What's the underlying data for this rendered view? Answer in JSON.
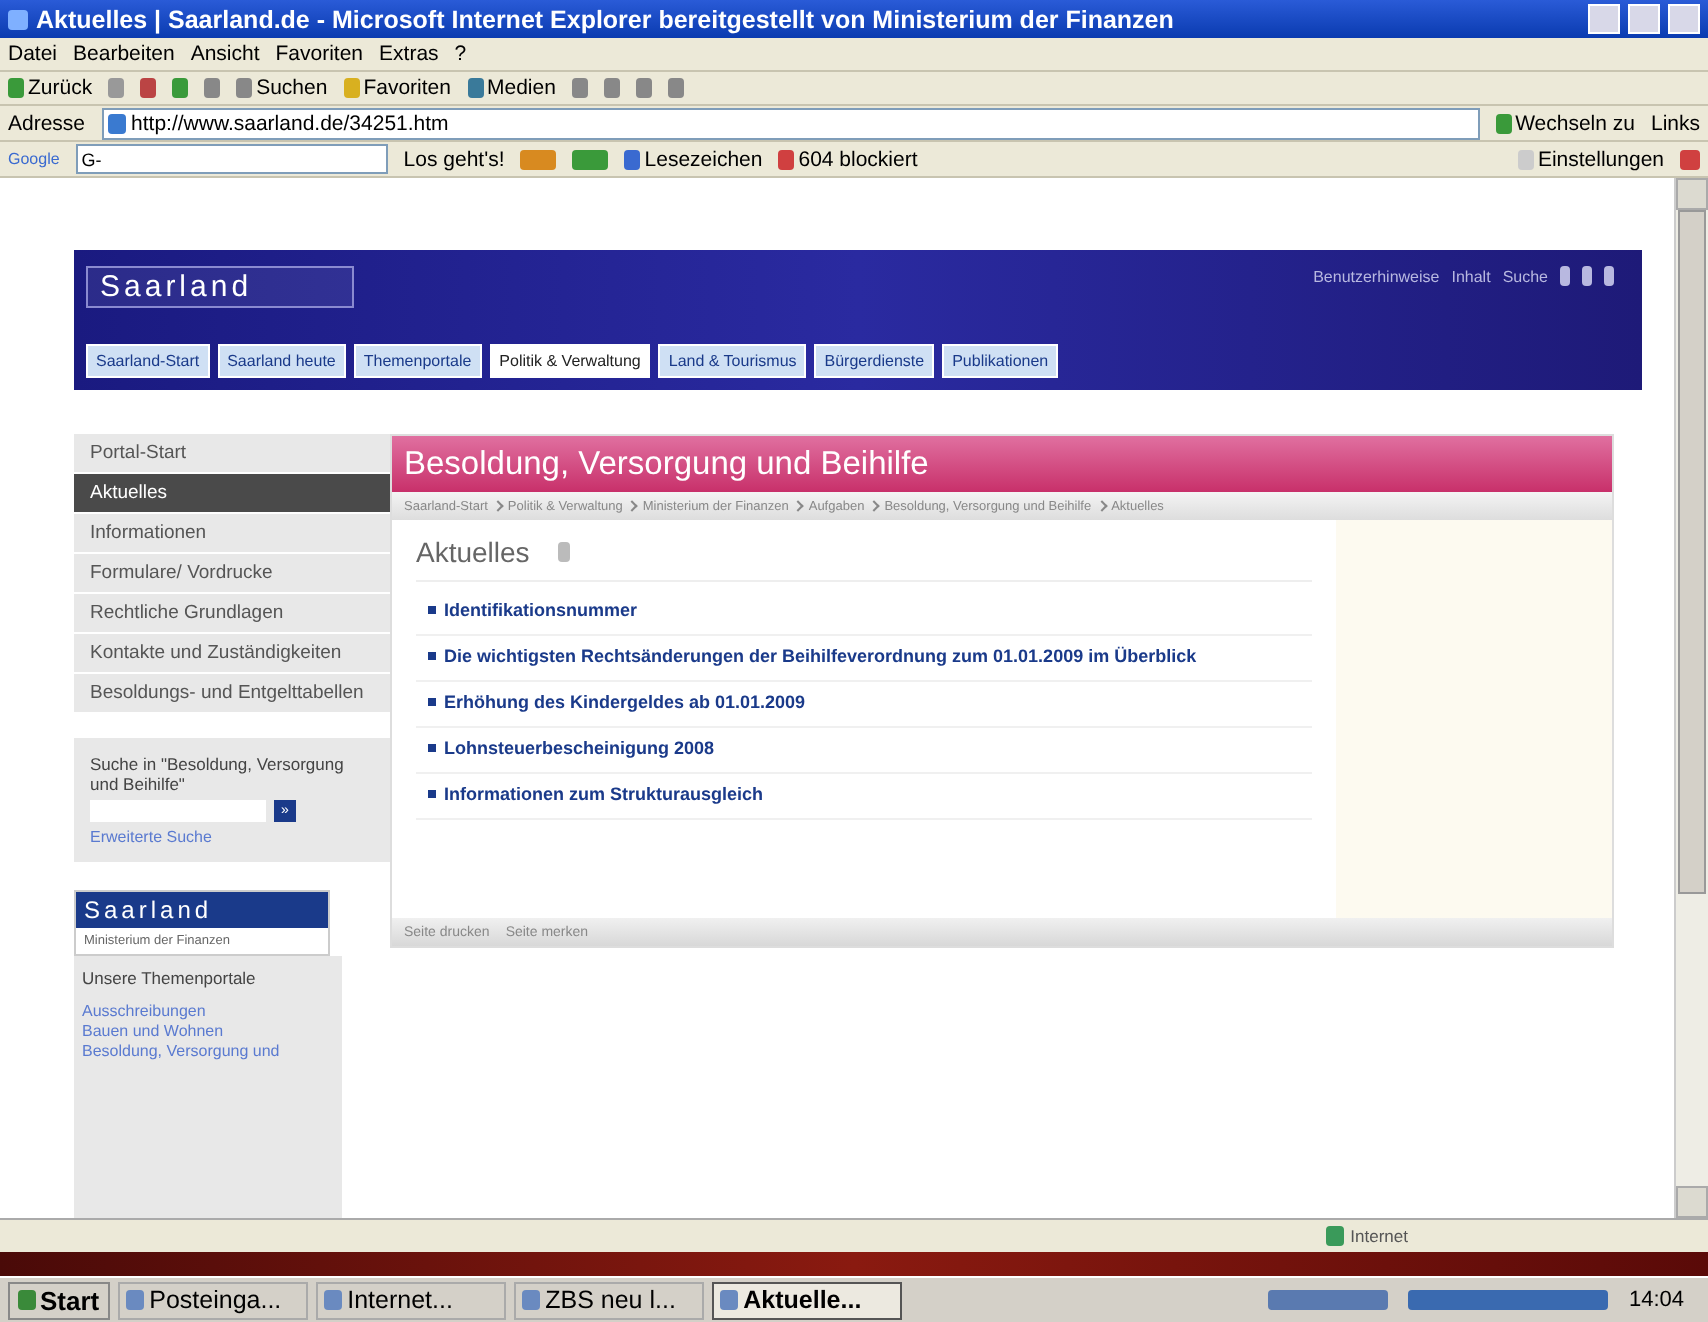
{
  "window": {
    "title": "Aktuelles | Saarland.de - Microsoft Internet Explorer bereitgestellt von Ministerium der Finanzen"
  },
  "menu": [
    "Datei",
    "Bearbeiten",
    "Ansicht",
    "Favoriten",
    "Extras",
    "?"
  ],
  "toolbar": {
    "back": "Zurück",
    "search": "Suchen",
    "favorites": "Favoriten",
    "media": "Medien"
  },
  "address_bar": {
    "label": "Adresse",
    "value": "http://www.saarland.de/34251.htm",
    "go": "Wechseln zu",
    "links": "Links"
  },
  "google_bar": {
    "logo": "Google",
    "field": "G-",
    "go": "Los geht's!",
    "bookmarks": "Lesezeichen",
    "blocked": "604 blockiert",
    "settings": "Einstellungen"
  },
  "site": {
    "logo": "Saarland",
    "header_links": [
      "Benutzerhinweise",
      "Inhalt",
      "Suche"
    ],
    "tabs": [
      {
        "label": "Saarland-Start",
        "selected": false
      },
      {
        "label": "Saarland heute",
        "selected": false
      },
      {
        "label": "Themenportale",
        "selected": false
      },
      {
        "label": "Politik & Verwaltung",
        "selected": true
      },
      {
        "label": "Land & Tourismus",
        "selected": false
      },
      {
        "label": "Bürgerdienste",
        "selected": false
      },
      {
        "label": "Publikationen",
        "selected": false
      }
    ],
    "sidebar": {
      "items": [
        {
          "label": "Portal-Start",
          "selected": false
        },
        {
          "label": "Aktuelles",
          "selected": true
        },
        {
          "label": "Informationen",
          "selected": false
        },
        {
          "label": "Formulare/ Vordrucke",
          "selected": false
        },
        {
          "label": "Rechtliche Grundlagen",
          "selected": false
        },
        {
          "label": "Kontakte und Zuständigkeiten",
          "selected": false
        },
        {
          "label": "Besoldungs- und Entgelttabellen",
          "selected": false
        }
      ],
      "search_label": "Suche in \"Besoldung, Versorgung und Beihilfe\"",
      "search_button": "»",
      "advanced_search": "Erweiterte Suche",
      "ministry_logo": "Saarland",
      "ministry": "Ministerium der Finanzen",
      "portals_title": "Unsere Themenportale",
      "portals": [
        "Ausschreibungen",
        "Bauen und Wohnen",
        "Besoldung, Versorgung und"
      ]
    },
    "content": {
      "title": "Besoldung, Versorgung und Beihilfe",
      "breadcrumb": [
        "Saarland-Start",
        "Politik & Verwaltung",
        "Ministerium der Finanzen",
        "Aufgaben",
        "Besoldung, Versorgung und Beihilfe",
        "Aktuelles"
      ],
      "heading": "Aktuelles",
      "links": [
        "Identifikationsnummer",
        "Die wichtigsten Rechtsänderungen der Beihilfeverordnung zum 01.01.2009 im Überblick",
        "Erhöhung des Kindergeldes ab 01.01.2009",
        "Lohnsteuerbescheinigung 2008",
        "Informationen zum Strukturausgleich"
      ],
      "footer": [
        "Seite drucken",
        "Seite merken"
      ]
    }
  },
  "status_bar": {
    "zone": "Internet"
  },
  "taskbar": {
    "start": "Start",
    "tasks": [
      {
        "label": "Posteinga...",
        "selected": false
      },
      {
        "label": "Internet...",
        "selected": false
      },
      {
        "label": "ZBS neu l...",
        "selected": false
      },
      {
        "label": "Aktuelle...",
        "selected": true
      }
    ],
    "clock": "14:04"
  }
}
